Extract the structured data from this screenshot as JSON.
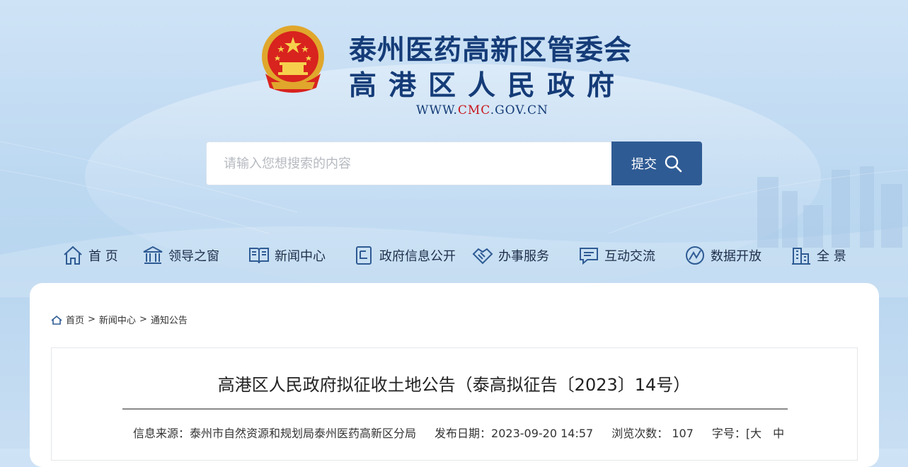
{
  "header": {
    "title_line1": "泰州医药高新区管委会",
    "title_line2": "高港区人民政府",
    "url_prefix": "WWW.",
    "url_domain": "CMC",
    "url_suffix": ".GOV.CN"
  },
  "search": {
    "placeholder": "请输入您想搜索的内容",
    "button_label": "提交"
  },
  "nav": {
    "items": [
      {
        "label": "首 页",
        "icon": "home-icon"
      },
      {
        "label": "领导之窗",
        "icon": "building-columns-icon"
      },
      {
        "label": "新闻中心",
        "icon": "open-book-icon"
      },
      {
        "label": "政府信息公开",
        "icon": "document-icon"
      },
      {
        "label": "办事服务",
        "icon": "handshake-icon"
      },
      {
        "label": "互动交流",
        "icon": "chat-icon"
      },
      {
        "label": "数据开放",
        "icon": "data-globe-icon"
      },
      {
        "label": "全 景",
        "icon": "city-building-icon"
      }
    ]
  },
  "breadcrumb": {
    "items": [
      "首页",
      "新闻中心",
      "通知公告"
    ],
    "separator": ">"
  },
  "article": {
    "title": "高港区人民政府拟征收土地公告（泰高拟征告〔2023〕14号）",
    "source_label": "信息来源：",
    "source_value": "泰州市自然资源和规划局泰州医药高新区分局",
    "date_label": "发布日期：",
    "date_value": "2023-09-20 14:57",
    "views_label": "浏览次数：",
    "views_value": "107",
    "fontsize_label": "字号：",
    "fontsize_options": "[大　中"
  },
  "colors": {
    "brand_blue": "#153c78",
    "button_blue": "#2f5b94",
    "url_red": "#c8161d"
  }
}
